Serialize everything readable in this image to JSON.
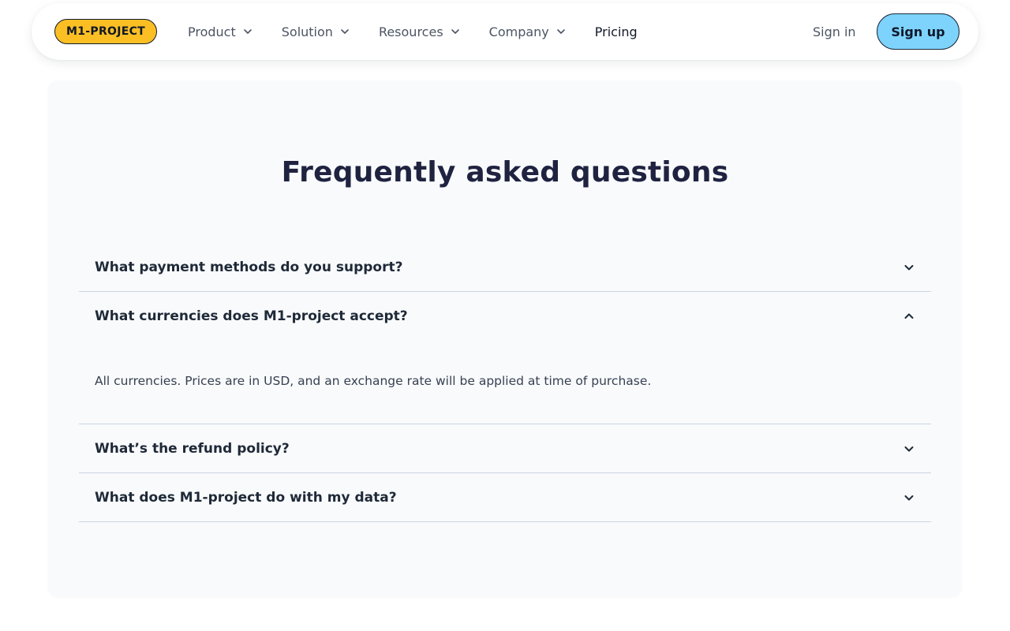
{
  "header": {
    "logo": "M1-PROJECT",
    "nav": [
      {
        "label": "Product",
        "has_dropdown": true
      },
      {
        "label": "Solution",
        "has_dropdown": true
      },
      {
        "label": "Resources",
        "has_dropdown": true
      },
      {
        "label": "Company",
        "has_dropdown": true
      },
      {
        "label": "Pricing",
        "has_dropdown": false
      }
    ],
    "sign_in": "Sign in",
    "sign_up": "Sign up"
  },
  "faq": {
    "title": "Frequently asked questions",
    "items": [
      {
        "question": "What payment methods do you support?",
        "expanded": false,
        "icon": "chevron-down-icon"
      },
      {
        "question": "What currencies does M1-project accept?",
        "expanded": true,
        "icon": "chevron-up-icon",
        "answer": "All currencies. Prices are in USD, and an exchange rate will be applied at time of purchase."
      },
      {
        "question": "What’s the refund policy?",
        "expanded": false,
        "icon": "chevron-down-icon"
      },
      {
        "question": "What does M1-project do with my data?",
        "expanded": false,
        "icon": "chevron-down-icon"
      }
    ]
  },
  "colors": {
    "logo_bg": "#fbbf24",
    "signup_bg": "#7dd3fc",
    "card_bg": "#f8fafc",
    "title": "#1f2340"
  }
}
